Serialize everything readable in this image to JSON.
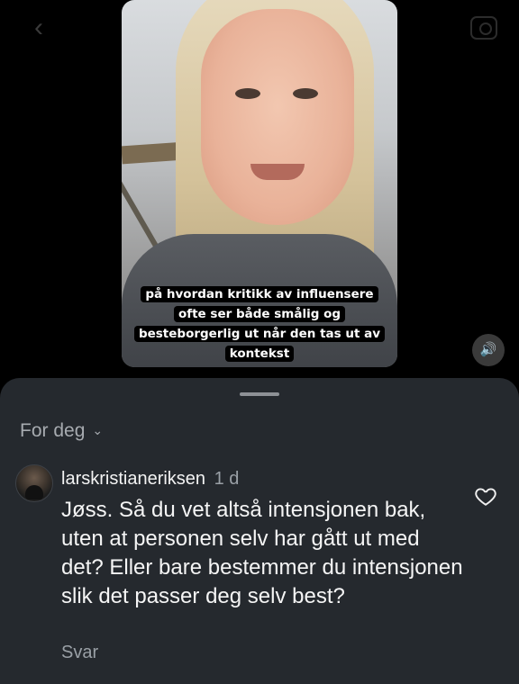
{
  "video": {
    "caption_lines": [
      "på hvordan kritikk av influensere",
      "ofte ser både smålig og",
      "besteborgerlig ut når den tas ut av",
      "kontekst"
    ],
    "sound_icon": "speaker-icon"
  },
  "nav": {
    "back_icon": "chevron-left-icon",
    "camera_icon": "camera-icon"
  },
  "comments": {
    "filter_label": "For deg",
    "filter_icon": "chevron-down-icon",
    "items": [
      {
        "username": "larskristianeriksen",
        "time": "1 d",
        "text": "Jøss. Så du vet altså intensjonen bak, uten at personen selv har gått ut med det? Eller bare bestemmer du intensjonen slik det passer deg selv best?",
        "reply_label": "Svar",
        "like_icon": "heart-icon"
      }
    ]
  }
}
